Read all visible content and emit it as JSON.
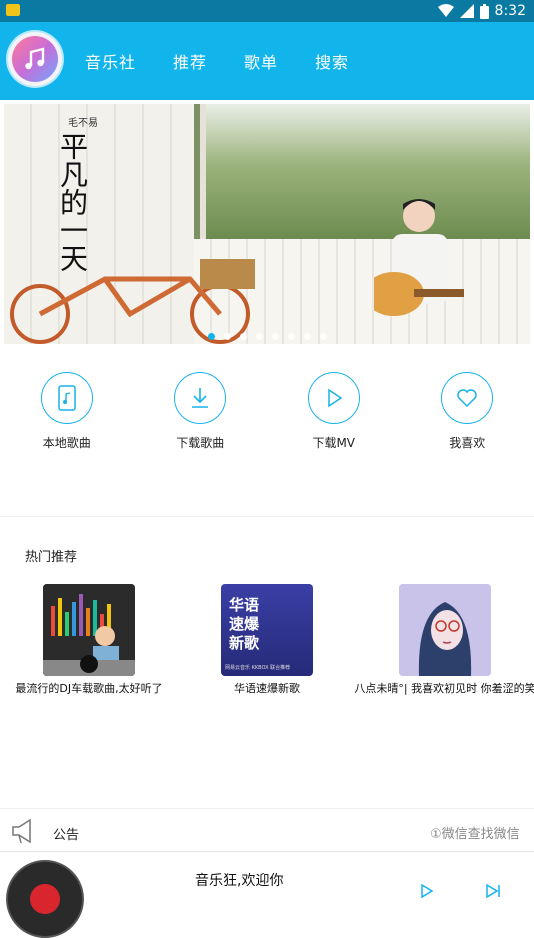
{
  "status_bar": {
    "time": "8:32"
  },
  "nav": {
    "tabs": [
      "音乐社",
      "推荐",
      "歌单",
      "搜索"
    ]
  },
  "banner": {
    "title": "平凡的一天",
    "artist": "毛不易",
    "slide_count": 8,
    "active_slide": 0
  },
  "quick_actions": [
    {
      "label": "本地歌曲",
      "icon": "phone-music-icon"
    },
    {
      "label": "下载歌曲",
      "icon": "download-icon"
    },
    {
      "label": "下载MV",
      "icon": "play-icon"
    },
    {
      "label": "我喜欢",
      "icon": "heart-icon"
    }
  ],
  "hot": {
    "title": "热门推荐",
    "items": [
      {
        "title": "最流行的DJ车载歌曲,太好听了"
      },
      {
        "title": "华语速爆新歌",
        "cover_text": [
          "华语",
          "速爆",
          "新歌"
        ],
        "cover_footer": "网易云音乐 KKBOX 联合推荐"
      },
      {
        "title": "八点未晴°| 我喜欢初见时 你羞涩的笑"
      }
    ]
  },
  "notice": {
    "label": "公告",
    "text": "①微信查找微信"
  },
  "player": {
    "title": "音乐狂,欢迎你"
  },
  "colors": {
    "primary": "#11b5ec",
    "status_bar": "#0a7aa3"
  }
}
